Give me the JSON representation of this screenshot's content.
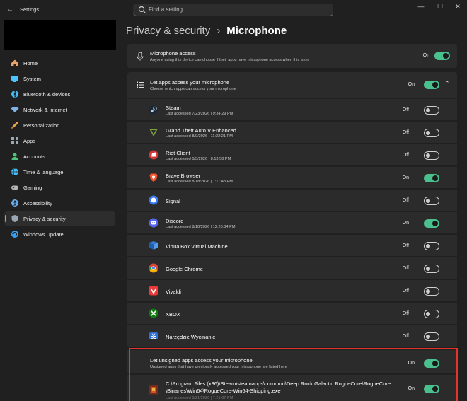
{
  "window": {
    "app_title": "Settings",
    "search_placeholder": "Find a setting",
    "minimize": "—",
    "maximize": "☐",
    "close": "✕"
  },
  "sidebar": {
    "items": [
      {
        "label": "Home",
        "icon": "home-icon",
        "color": "#e8a36a"
      },
      {
        "label": "System",
        "icon": "monitor-icon",
        "color": "#4cc2ff"
      },
      {
        "label": "Bluetooth & devices",
        "icon": "bluetooth-icon",
        "color": "#4cc2ff"
      },
      {
        "label": "Network & internet",
        "icon": "wifi-icon",
        "color": "#7fb3e6"
      },
      {
        "label": "Personalization",
        "icon": "brush-icon",
        "color": "#e6a34c"
      },
      {
        "label": "Apps",
        "icon": "apps-icon",
        "color": "#9fa7b5"
      },
      {
        "label": "Accounts",
        "icon": "person-icon",
        "color": "#4fc37a"
      },
      {
        "label": "Time & language",
        "icon": "globe-icon",
        "color": "#4cc2ff"
      },
      {
        "label": "Gaming",
        "icon": "gamepad-icon",
        "color": "#b5b5b5"
      },
      {
        "label": "Accessibility",
        "icon": "accessibility-icon",
        "color": "#6aaef0"
      },
      {
        "label": "Privacy & security",
        "icon": "shield-icon",
        "color": "#9aa5b5",
        "selected": true
      },
      {
        "label": "Windows Update",
        "icon": "update-icon",
        "color": "#3ba0f0"
      }
    ]
  },
  "breadcrumb": {
    "parent": "Privacy & security",
    "separator": "›",
    "current": "Microphone"
  },
  "mic_access": {
    "title": "Microphone access",
    "desc": "Anyone using this device can choose if their apps have microphone access when this is on",
    "state": "On"
  },
  "let_apps": {
    "title": "Let apps access your microphone",
    "desc": "Choose which apps can access your microphone",
    "state": "On",
    "chevron": "⌃"
  },
  "apps": [
    {
      "name": "Steam",
      "meta": "Last accessed 7/23/2026  |  9:34:29 PM",
      "state": "Off",
      "icon": "steam-icon"
    },
    {
      "name": "Grand Theft Auto V Enhanced",
      "meta": "Last accessed 8/9/2026  |  11:22:21 PM",
      "state": "Off",
      "icon": "gta-icon"
    },
    {
      "name": "Riot Client",
      "meta": "Last accessed 5/5/2026  |  8:13:58 PM",
      "state": "Off",
      "icon": "riot-icon"
    },
    {
      "name": "Brave Browser",
      "meta": "Last accessed 8/18/2026  |  1:11:48 PM",
      "state": "On",
      "icon": "brave-icon"
    },
    {
      "name": "Signal",
      "meta": "",
      "state": "Off",
      "icon": "signal-icon"
    },
    {
      "name": "Discord",
      "meta": "Last accessed 8/18/2026  |  12:20:34 PM",
      "state": "On",
      "icon": "discord-icon"
    },
    {
      "name": "VirtualBox Virtual Machine",
      "meta": "",
      "state": "Off",
      "icon": "virtualbox-icon"
    },
    {
      "name": "Google Chrome",
      "meta": "",
      "state": "Off",
      "icon": "chrome-icon"
    },
    {
      "name": "Vivaldi",
      "meta": "",
      "state": "Off",
      "icon": "vivaldi-icon"
    },
    {
      "name": "XBOX",
      "meta": "",
      "state": "Off",
      "icon": "xbox-icon"
    },
    {
      "name": "Narzędzie Wycinanie",
      "meta": "",
      "state": "Off",
      "icon": "snipping-icon"
    }
  ],
  "unsigned": {
    "title": "Let unsigned apps access your microphone",
    "desc": "Unsigned apps that have previously accessed your microphone are listed here",
    "state": "On",
    "app_line1": "C:\\Program Files (x86)\\Steam\\steamapps\\common\\Deep Rock Galactic RogueCore\\RogueCore",
    "app_line2": "\\Binaries\\Win64\\RogueCore-Win64-Shipping.exe",
    "app_meta": "Last accessed 8/21/2026  |  7:21:07 PM",
    "app_state": "On",
    "icon": "roguecore-icon"
  },
  "colors": {
    "accent": "#4cc2ff",
    "toggle_on": "#49c08e",
    "highlight": "#e5332a"
  }
}
